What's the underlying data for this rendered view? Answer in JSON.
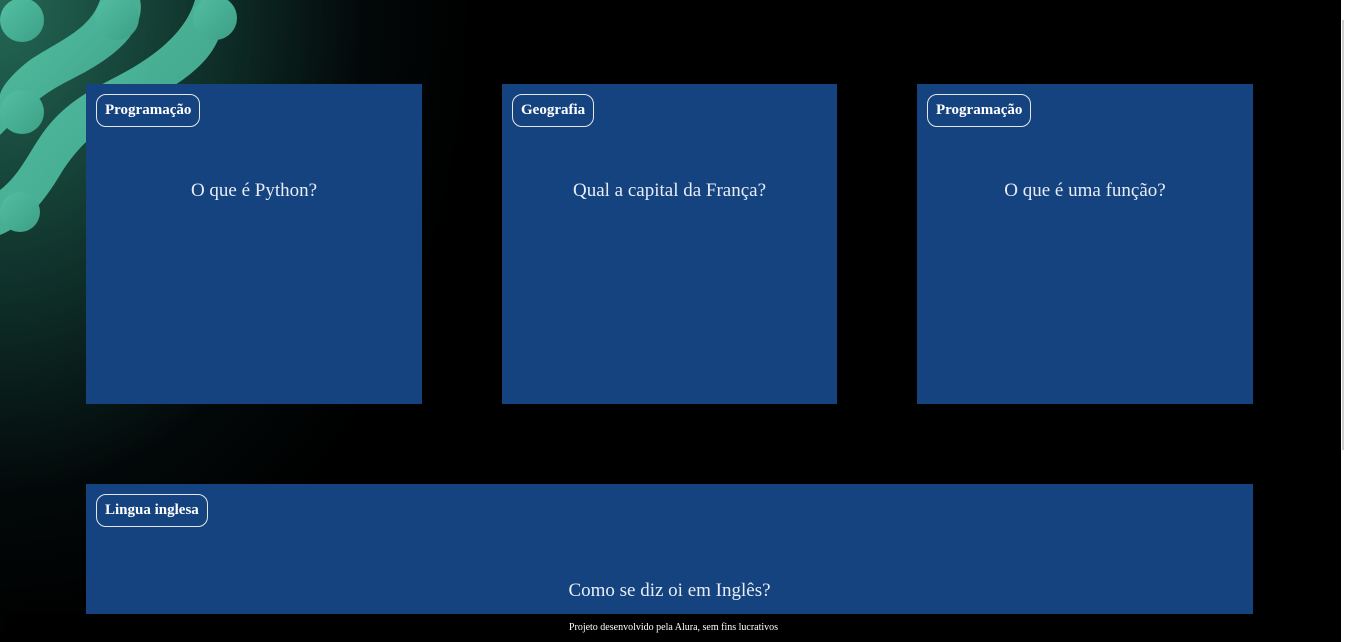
{
  "cards": [
    {
      "tag": "Programação",
      "question": "O que é Python?"
    },
    {
      "tag": "Geografia",
      "question": "Qual a capital da França?"
    },
    {
      "tag": "Programação",
      "question": "O que é uma função?"
    },
    {
      "tag": "Lingua inglesa",
      "question": "Como se diz oi em Inglês?"
    }
  ],
  "footer": {
    "text": "Projeto desenvolvido pela Alura, sem fins lucrativos"
  },
  "colors": {
    "card_background": "#14437f",
    "page_background": "#000000",
    "accent_teal": "#4fbfa0"
  }
}
